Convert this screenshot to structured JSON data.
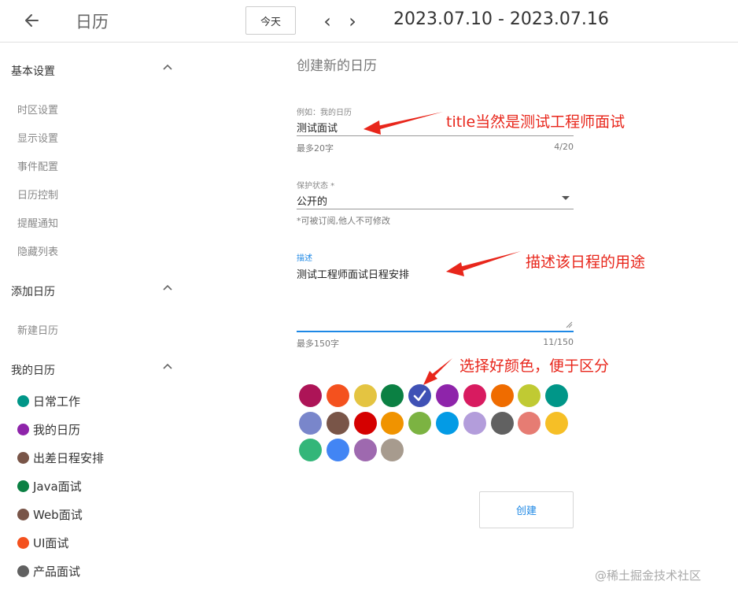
{
  "header": {
    "title": "日历",
    "today_label": "今天",
    "prev_glyph": "‹",
    "next_glyph": "›",
    "date_range": "2023.07.10 - 2023.07.16"
  },
  "sidebar": {
    "basic": {
      "title": "基本设置",
      "items": [
        "时区设置",
        "显示设置",
        "事件配置",
        "日历控制",
        "提醒通知",
        "隐藏列表"
      ]
    },
    "add": {
      "title": "添加日历",
      "items": [
        "新建日历"
      ]
    },
    "mine": {
      "title": "我的日历",
      "calendars": [
        {
          "label": "日常工作",
          "color": "#009688"
        },
        {
          "label": "我的日历",
          "color": "#8e24aa"
        },
        {
          "label": "出差日程安排",
          "color": "#795548"
        },
        {
          "label": "Java面试",
          "color": "#0b8043"
        },
        {
          "label": "Web面试",
          "color": "#795548"
        },
        {
          "label": "UI面试",
          "color": "#f4511e"
        },
        {
          "label": "产品面试",
          "color": "#616161"
        }
      ]
    }
  },
  "form": {
    "heading": "创建新的日历",
    "title_field": {
      "label": "例如：我的日历",
      "value": "测试面试",
      "hint": "最多20字",
      "counter": "4/20"
    },
    "protect_field": {
      "label": "保护状态 *",
      "value": "公开的",
      "hint": "*可被订阅,他人不可修改"
    },
    "desc_field": {
      "label": "描述",
      "value": "测试工程师面试日程安排",
      "hint": "最多150字",
      "counter": "11/150"
    },
    "colors": [
      "#ad1457",
      "#f4511e",
      "#e4c441",
      "#0b8043",
      "#3f51b5",
      "#8e24aa",
      "#d81b60",
      "#ef6c00",
      "#c0ca33",
      "#009688",
      "#7986cb",
      "#795548",
      "#d50000",
      "#f09300",
      "#7cb342",
      "#039be5",
      "#b39ddb",
      "#616161",
      "#e67c73",
      "#f6bf26",
      "#33b679",
      "#4285f4",
      "#9e69af",
      "#a79b8e"
    ],
    "selected_color_index": 4,
    "create_label": "创建"
  },
  "annotations": {
    "title_note": "title当然是测试工程师面试",
    "desc_note": "描述该日程的用途",
    "color_note": "选择好颜色，便于区分"
  },
  "watermark": "@稀土掘金技术社区"
}
